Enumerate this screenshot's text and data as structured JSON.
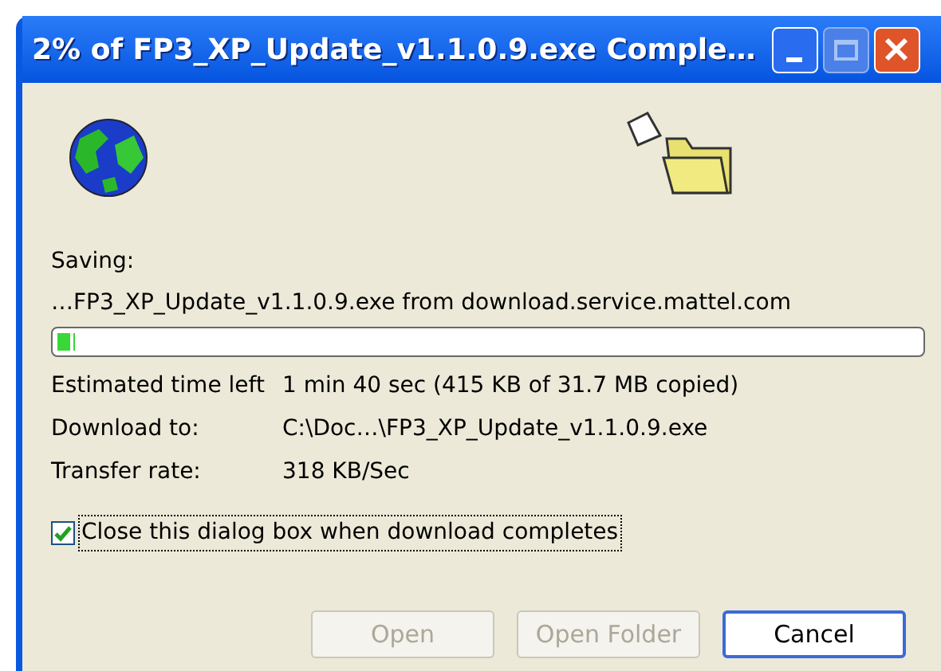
{
  "window": {
    "title": "2% of FP3_XP_Update_v1.1.0.9.exe Comple…"
  },
  "saving": {
    "label": "Saving:",
    "source": "…FP3_XP_Update_v1.1.0.9.exe from download.service.mattel.com"
  },
  "progress": {
    "level": 0.02
  },
  "details": [
    {
      "label": "Estimated time left",
      "value": "1 min 40 sec (415 KB of 31.7 MB copied)"
    },
    {
      "label": "Download to:",
      "value": "C:\\Doc…\\FP3_XP_Update_v1.1.0.9.exe"
    },
    {
      "label": "Transfer rate:",
      "value": "318 KB/Sec"
    }
  ],
  "close_when_done": {
    "label": "Close this dialog box when download completes",
    "checked": true
  },
  "buttons": [
    {
      "label": "Open",
      "disabled": true
    },
    {
      "label": "Open Folder",
      "disabled": true
    },
    {
      "label": "Cancel",
      "disabled": false
    }
  ]
}
